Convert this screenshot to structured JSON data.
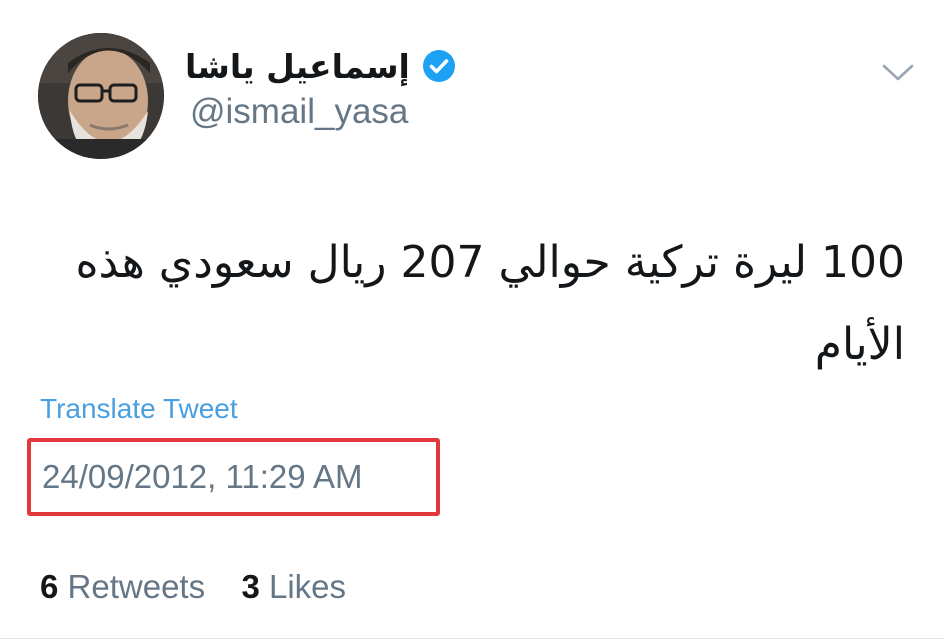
{
  "author": {
    "display_name": "إسماعيل ياشا",
    "handle": "@ismail_yasa",
    "verified": true,
    "avatar_icon": "user-avatar"
  },
  "menu": {
    "icon": "chevron-down-icon"
  },
  "tweet": {
    "text": "100 ليرة تركية حوالي 207 ريال سعودي هذه الأيام",
    "translate_label": "Translate Tweet",
    "timestamp": "24/09/2012, 11:29 AM"
  },
  "stats": {
    "retweets_count": "6",
    "retweets_label": "Retweets",
    "likes_count": "3",
    "likes_label": "Likes"
  },
  "colors": {
    "link": "#4a9fe0",
    "muted": "#657786",
    "highlight_border": "#e0383b",
    "verified_badge": "#1da1f2"
  }
}
